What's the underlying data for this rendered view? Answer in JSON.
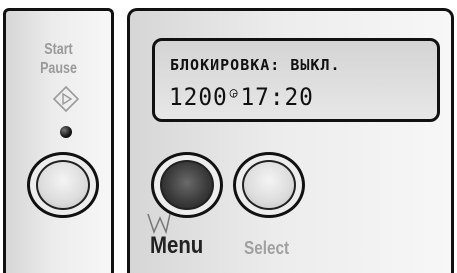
{
  "left_panel": {
    "start_label": "Start",
    "pause_label": "Pause",
    "icon": "diamond-start-icon",
    "led": "status-led"
  },
  "lcd": {
    "line1": "БЛОКИРОВКА: ВЫКЛ.",
    "line2_left": "1200",
    "line2_symbol": "clock-symbol",
    "line2_right": "17:20"
  },
  "buttons": {
    "menu_label": "Menu",
    "select_label": "Select"
  },
  "colors": {
    "panel_border": "#111111",
    "label_gray": "#9a9a9a",
    "menu_label": "#222222"
  }
}
